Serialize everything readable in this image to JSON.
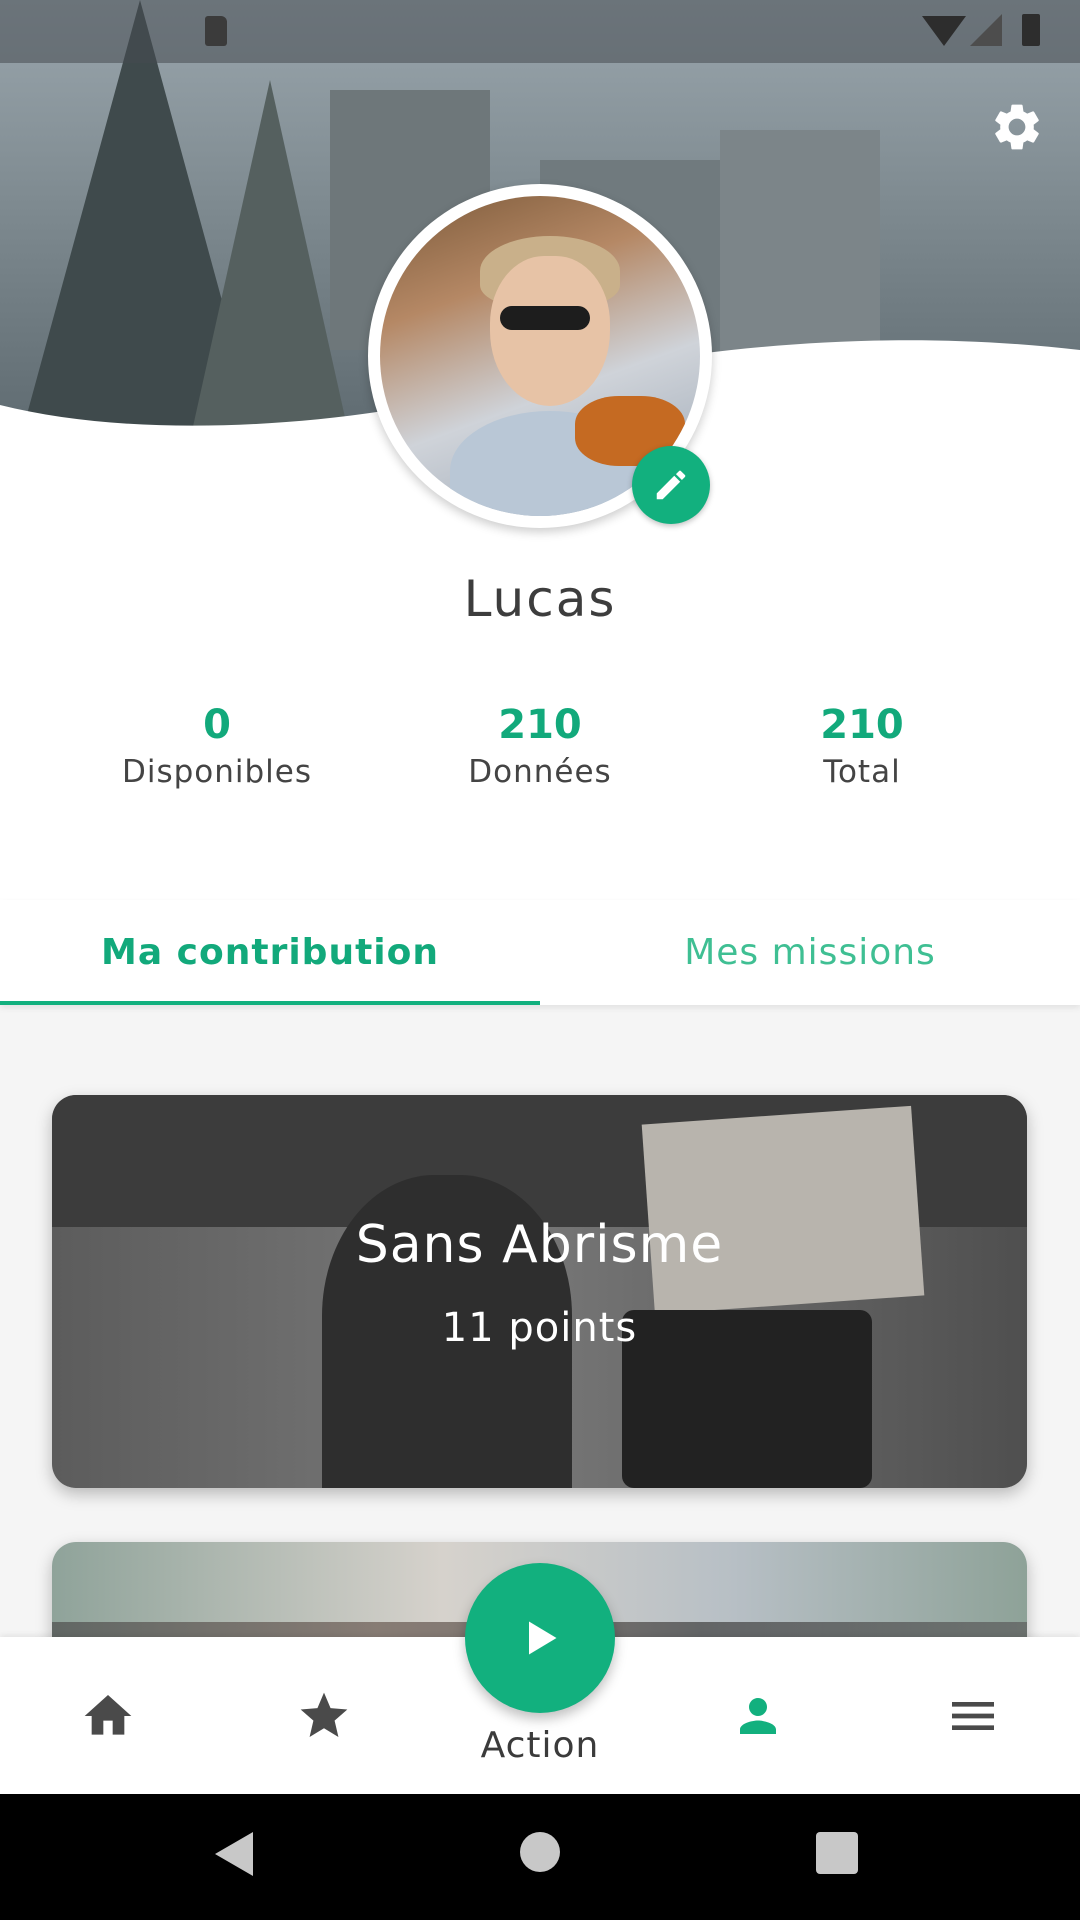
{
  "user": {
    "name": "Lucas"
  },
  "stats": [
    {
      "value": "0",
      "label": "Disponibles"
    },
    {
      "value": "210",
      "label": "Données"
    },
    {
      "value": "210",
      "label": "Total"
    }
  ],
  "tabs": [
    {
      "label": "Ma contribution",
      "active": true
    },
    {
      "label": "Mes missions",
      "active": false
    }
  ],
  "cards": [
    {
      "title": "Sans Abrisme",
      "points": "11 points"
    }
  ],
  "bottom_nav": {
    "action_label": "Action",
    "items": [
      "home-icon",
      "star-icon",
      "play-icon",
      "person-icon",
      "menu-icon"
    ],
    "active": "person-icon"
  },
  "colors": {
    "accent": "#12b07e",
    "stat_value": "#12a97b",
    "tab_inactive": "#3fbf93"
  }
}
